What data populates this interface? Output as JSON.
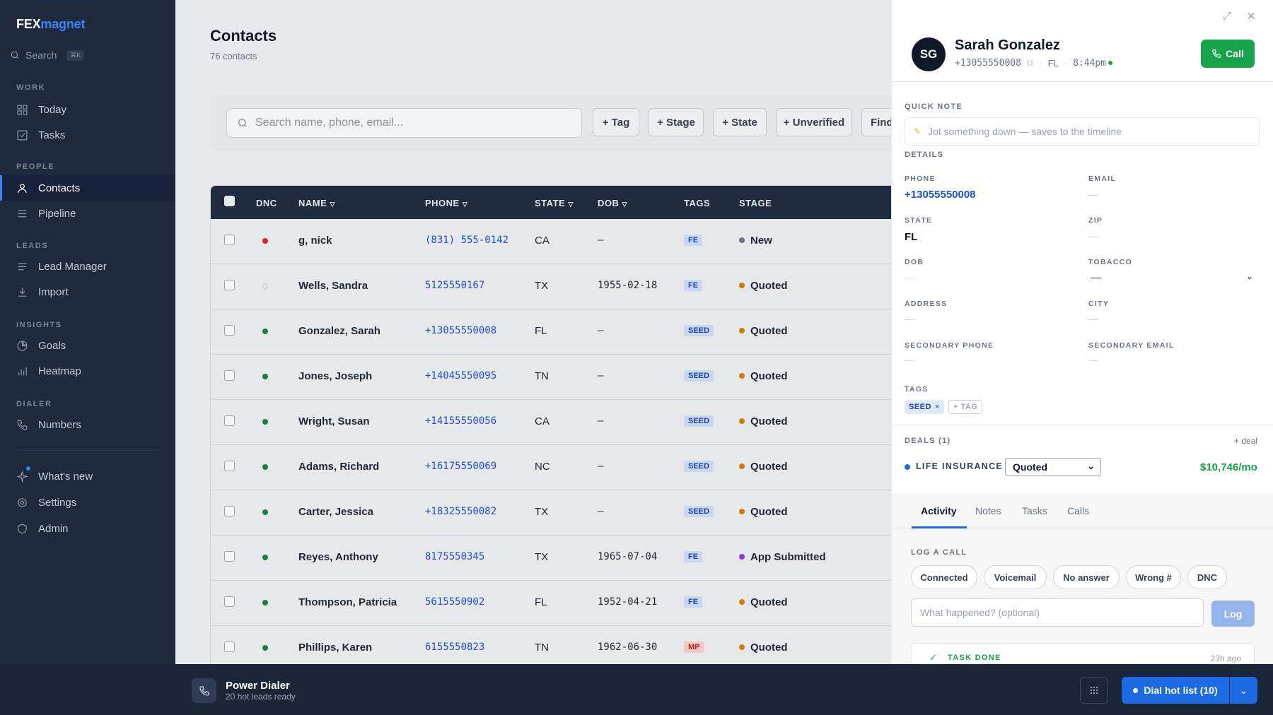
{
  "brand": {
    "part1": "FEX",
    "part2": "magnet"
  },
  "sidebar": {
    "search_label": "Search",
    "search_kbd": "⌘K",
    "sections": {
      "work": "WORK",
      "people": "PEOPLE",
      "leads": "LEADS",
      "insights": "INSIGHTS",
      "dialer": "DIALER"
    },
    "items": {
      "today": "Today",
      "tasks": "Tasks",
      "contacts": "Contacts",
      "pipeline": "Pipeline",
      "lead_manager": "Lead Manager",
      "import": "Import",
      "goals": "Goals",
      "heatmap": "Heatmap",
      "numbers": "Numbers",
      "whats_new": "What's new",
      "settings": "Settings",
      "admin": "Admin"
    }
  },
  "main": {
    "title": "Contacts",
    "count": "76 contacts",
    "search_placeholder": "Search name, phone, email...",
    "chips": [
      "+ Tag",
      "+ Stage",
      "+ State",
      "+ Unverified",
      "Find"
    ],
    "columns": {
      "dnc": "DNC",
      "name": "NAME",
      "phone": "PHONE",
      "state": "STATE",
      "dob": "DOB",
      "tags": "TAGS",
      "stage": "STAGE"
    },
    "sort_arrow": "▽",
    "rows": [
      {
        "name": "g, nick",
        "phone": "(831) 555-0142",
        "state": "CA",
        "dob": "–",
        "tag": "FE",
        "stage": "New",
        "dnc": "red",
        "stage_color": "#6b7280"
      },
      {
        "name": "Wells, Sandra",
        "phone": "5125550167",
        "state": "TX",
        "dob": "1955-02-18",
        "tag": "FE",
        "stage": "Quoted",
        "dnc": "none",
        "stage_color": "#d97706"
      },
      {
        "name": "Gonzalez, Sarah",
        "phone": "+13055550008",
        "state": "FL",
        "dob": "–",
        "tag": "SEED",
        "stage": "Quoted",
        "dnc": "green",
        "stage_color": "#d97706"
      },
      {
        "name": "Jones, Joseph",
        "phone": "+14045550095",
        "state": "TN",
        "dob": "–",
        "tag": "SEED",
        "stage": "Quoted",
        "dnc": "green",
        "stage_color": "#d97706"
      },
      {
        "name": "Wright, Susan",
        "phone": "+14155550056",
        "state": "CA",
        "dob": "–",
        "tag": "SEED",
        "stage": "Quoted",
        "dnc": "green",
        "stage_color": "#d97706"
      },
      {
        "name": "Adams, Richard",
        "phone": "+16175550069",
        "state": "NC",
        "dob": "–",
        "tag": "SEED",
        "stage": "Quoted",
        "dnc": "green",
        "stage_color": "#d97706"
      },
      {
        "name": "Carter, Jessica",
        "phone": "+18325550082",
        "state": "TX",
        "dob": "–",
        "tag": "SEED",
        "stage": "Quoted",
        "dnc": "green",
        "stage_color": "#d97706"
      },
      {
        "name": "Reyes, Anthony",
        "phone": "8175550345",
        "state": "TX",
        "dob": "1965-07-04",
        "tag": "FE",
        "stage": "App Submitted",
        "dnc": "green",
        "stage_color": "#9333ea"
      },
      {
        "name": "Thompson, Patricia",
        "phone": "5615550902",
        "state": "FL",
        "dob": "1952-04-21",
        "tag": "FE",
        "stage": "Quoted",
        "dnc": "green",
        "stage_color": "#d97706"
      },
      {
        "name": "Phillips, Karen",
        "phone": "6155550823",
        "state": "TN",
        "dob": "1962-06-30",
        "tag": "MP",
        "stage": "Quoted",
        "dnc": "green",
        "stage_color": "#d97706"
      }
    ]
  },
  "panel": {
    "initials": "SG",
    "name": "Sarah Gonzalez",
    "phone": "+13055550008",
    "state": "FL",
    "time": "8:44pm",
    "call_label": "Call",
    "quick_note_label": "QUICK NOTE",
    "quick_note_placeholder": "Jot something down — saves to the timeline",
    "details_label": "DETAILS",
    "fields": {
      "phone_label": "PHONE",
      "phone": "+13055550008",
      "email_label": "EMAIL",
      "email": "—",
      "state_label": "STATE",
      "state": "FL",
      "zip_label": "ZIP",
      "zip": "—",
      "dob_label": "DOB",
      "dob": "—",
      "tobacco_label": "TOBACCO",
      "tobacco": "—",
      "address_label": "ADDRESS",
      "address": "—",
      "city_label": "CITY",
      "city": "—",
      "secondary_phone_label": "SECONDARY PHONE",
      "secondary_phone": "—",
      "secondary_email_label": "SECONDARY EMAIL",
      "secondary_email": "—"
    },
    "tags_label": "TAGS",
    "tag_seed": "SEED",
    "tag_remove": "×",
    "add_tag": "+ TAG",
    "deals_label": "DEALS (1)",
    "add_deal": "+ deal",
    "deal_name": "LIFE INSURANCE",
    "deal_stage": "Quoted",
    "deal_amount": "$10,746/mo",
    "tabs": [
      "Activity",
      "Notes",
      "Tasks",
      "Calls"
    ],
    "log_label": "LOG A CALL",
    "log_options": [
      "Connected",
      "Voicemail",
      "No answer",
      "Wrong #",
      "DNC"
    ],
    "log_placeholder": "What happened? (optional)",
    "log_button": "Log",
    "task_done": "TASK DONE",
    "task_time": "23h ago"
  },
  "bottom": {
    "title": "Power Dialer",
    "subtitle": "20 hot leads ready",
    "dial_button": "Dial hot list (10)"
  },
  "colors": {
    "accent": "#1d6ae5",
    "success": "#16a34a",
    "sidebar": "#1e2a3d"
  }
}
